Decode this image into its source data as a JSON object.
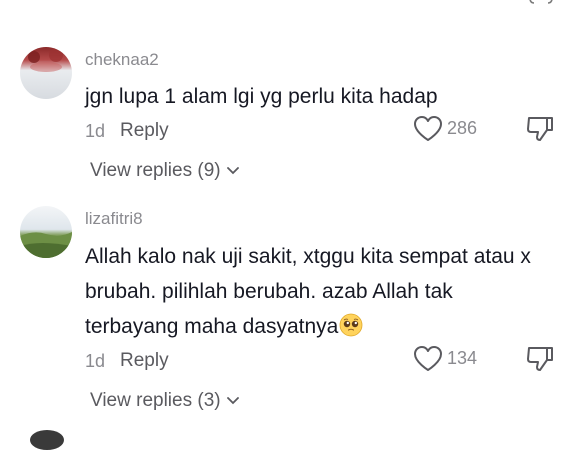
{
  "comments": [
    {
      "username": "cheknaa2",
      "text": "jgn lupa 1 alam lgi yg perlu kita hadap",
      "time": "1d",
      "reply_label": "Reply",
      "likes": "286",
      "view_replies": "View replies (9)"
    },
    {
      "username": "lizafitri8",
      "text": "Allah kalo nak uji sakit, xtggu kita sempat atau x brubah. pilihlah berubah. azab Allah tak terbayang maha dasyatnya",
      "time": "1d",
      "reply_label": "Reply",
      "likes": "134",
      "view_replies": "View replies (3)"
    }
  ],
  "colors": {
    "username": "#8a8a8f",
    "body_text": "#161823",
    "secondary": "#5a5a5f",
    "background": "#ffffff"
  },
  "icons": {
    "like": "heart-outline",
    "dislike": "thumbs-down-outline",
    "expand": "chevron-down",
    "emoji": "pleading-face"
  }
}
